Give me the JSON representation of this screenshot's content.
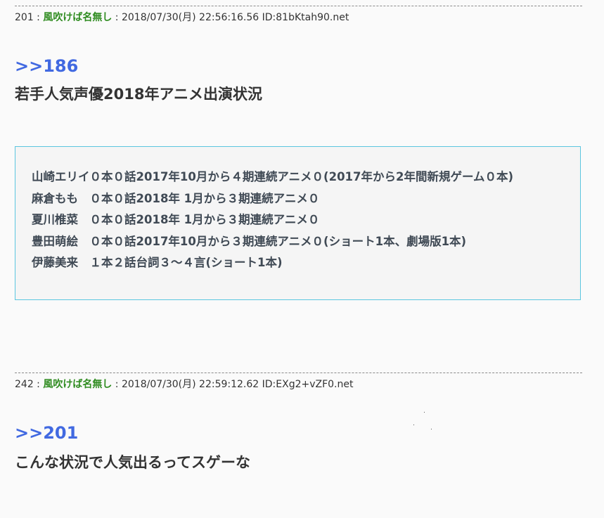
{
  "posts": [
    {
      "number": "201",
      "sep": " : ",
      "name": "風吹けば名無し",
      "datetime_id": " : 2018/07/30(月) 22:56:16.56 ID:81bKtah90.net",
      "anchor": ">>186",
      "text": "若手人気声優2018年アニメ出演状況",
      "quote_lines": [
        "山崎エリイ０本０話2017年10月から４期連続アニメ０(2017年から2年間新規ゲーム０本)",
        "麻倉もも　０本０話2018年 1月から３期連続アニメ０",
        "夏川椎菜　０本０話2018年 1月から３期連続アニメ０",
        "豊田萌絵　０本０話2017年10月から３期連続アニメ０(ショート1本、劇場版1本)",
        "伊藤美来　１本２話台詞３～４言(ショート1本)"
      ]
    },
    {
      "number": "242",
      "sep": " : ",
      "name": "風吹けば名無し",
      "datetime_id": " : 2018/07/30(月) 22:59:12.62 ID:EXg2+vZF0.net",
      "anchor": ">>201",
      "text": "こんな状況で人気出るってスゲーな"
    }
  ],
  "colors": {
    "name": "#2e8b1f",
    "anchor": "#4169e1",
    "quote_border": "#5bc6e0",
    "background": "#fafafa"
  }
}
